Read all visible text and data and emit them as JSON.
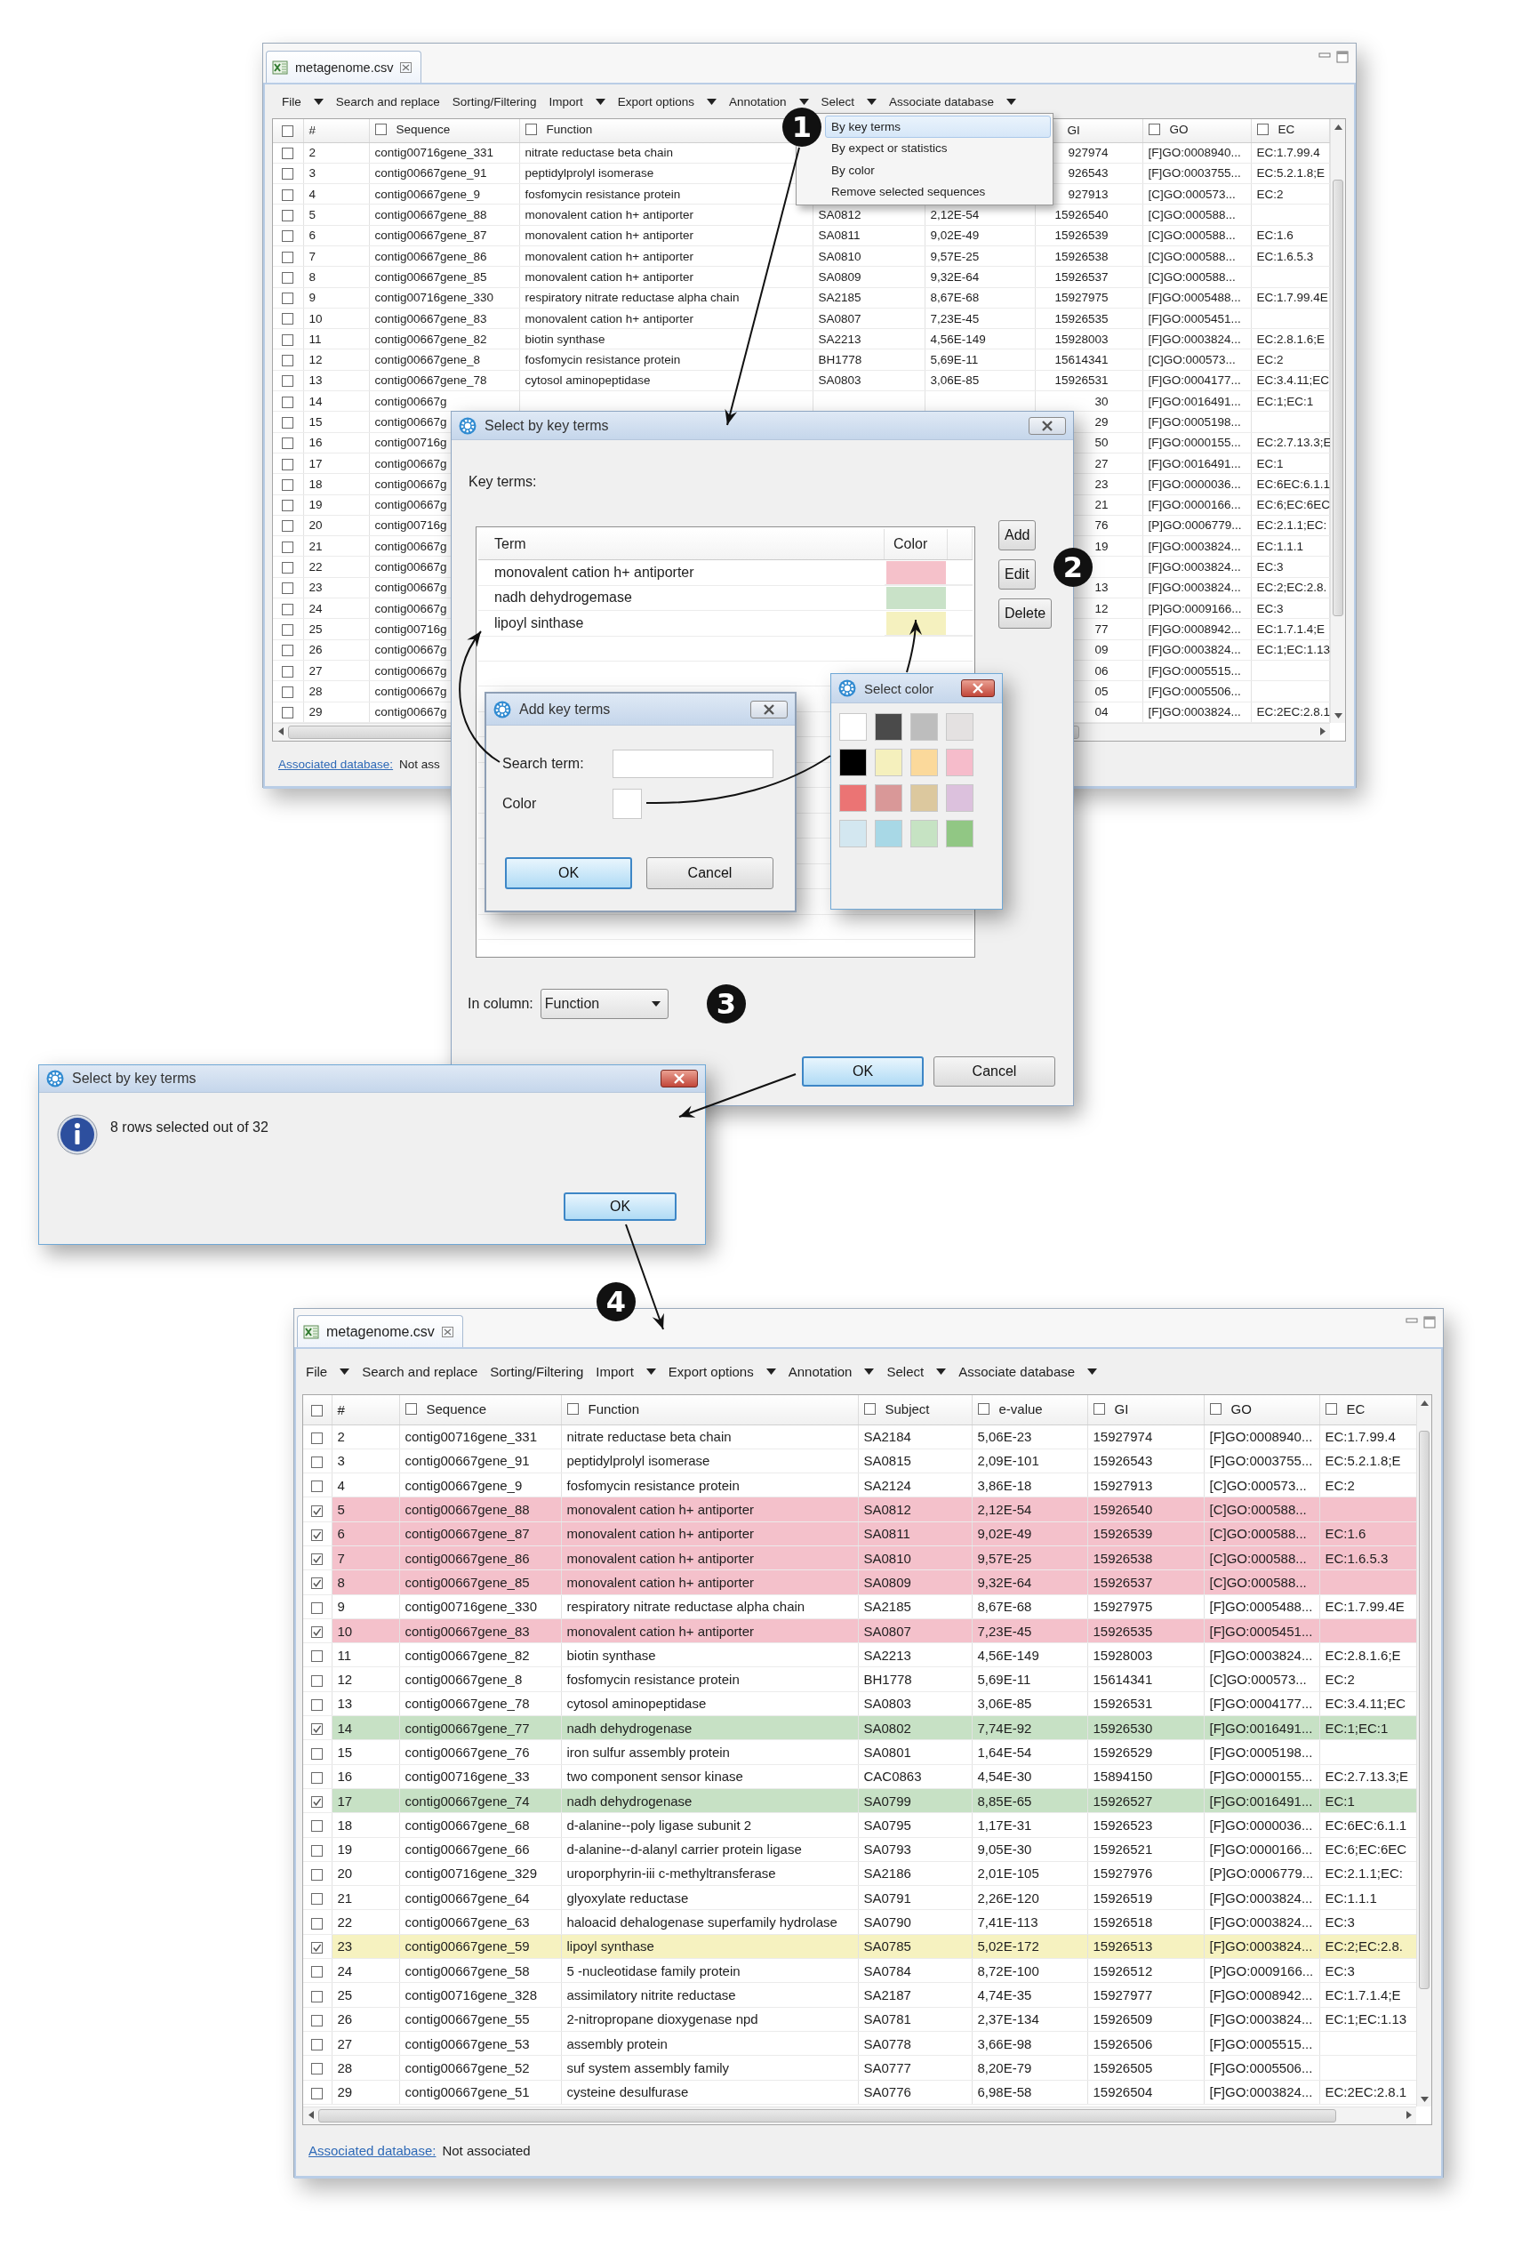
{
  "main_window": {
    "tab": {
      "title": "metagenome.csv"
    },
    "toolbar": [
      {
        "label": "File",
        "dropdown": true
      },
      {
        "label": "Search and replace",
        "dropdown": false
      },
      {
        "label": "Sorting/Filtering",
        "dropdown": false
      },
      {
        "label": "Import",
        "dropdown": true
      },
      {
        "label": "Export options",
        "dropdown": true
      },
      {
        "label": "Annotation",
        "dropdown": true
      },
      {
        "label": "Select",
        "dropdown": true
      },
      {
        "label": "Associate database",
        "dropdown": true
      }
    ],
    "select_menu": [
      {
        "label": "By key terms",
        "selected": true
      },
      {
        "label": "By expect or statistics",
        "selected": false
      },
      {
        "label": "By color",
        "selected": false
      },
      {
        "label": "Remove selected sequences",
        "selected": false
      }
    ],
    "table": {
      "select_all": {
        "checked": false
      },
      "columns": [
        {
          "label": "#"
        },
        {
          "label": "Sequence",
          "checked": false
        },
        {
          "label": "Function",
          "checked": false
        },
        null,
        null,
        {
          "label": "GI"
        },
        {
          "label": "GO",
          "checked": false
        },
        {
          "label": "EC",
          "checked": false
        }
      ],
      "rows": [
        {
          "checked": false,
          "cells": [
            "2",
            "contig00716gene_331",
            "nitrate reductase beta chain",
            null,
            null,
            "927974",
            "[F]GO:0008940...",
            "EC:1.7.99.4"
          ]
        },
        {
          "checked": false,
          "cells": [
            "3",
            "contig00667gene_91",
            "peptidylprolyl isomerase",
            null,
            null,
            "926543",
            "[F]GO:0003755...",
            "EC:5.2.1.8;E"
          ]
        },
        {
          "checked": false,
          "cells": [
            "4",
            "contig00667gene_9",
            "fosfomycin resistance protein",
            null,
            null,
            "927913",
            "[C]GO:000573...",
            "EC:2"
          ]
        },
        {
          "checked": false,
          "cells": [
            "5",
            "contig00667gene_88",
            "monovalent cation h+ antiporter",
            "SA0812",
            "2,12E-54",
            "15926540",
            "[C]GO:000588...",
            null
          ]
        },
        {
          "checked": false,
          "cells": [
            "6",
            "contig00667gene_87",
            "monovalent cation h+ antiporter",
            "SA0811",
            "9,02E-49",
            "15926539",
            "[C]GO:000588...",
            "EC:1.6"
          ]
        },
        {
          "checked": false,
          "cells": [
            "7",
            "contig00667gene_86",
            "monovalent cation h+ antiporter",
            "SA0810",
            "9,57E-25",
            "15926538",
            "[C]GO:000588...",
            "EC:1.6.5.3"
          ]
        },
        {
          "checked": false,
          "cells": [
            "8",
            "contig00667gene_85",
            "monovalent cation h+ antiporter",
            "SA0809",
            "9,32E-64",
            "15926537",
            "[C]GO:000588...",
            null
          ]
        },
        {
          "checked": false,
          "cells": [
            "9",
            "contig00716gene_330",
            "respiratory nitrate reductase alpha chain",
            "SA2185",
            "8,67E-68",
            "15927975",
            "[F]GO:0005488...",
            "EC:1.7.99.4E"
          ]
        },
        {
          "checked": false,
          "cells": [
            "10",
            "contig00667gene_83",
            "monovalent cation h+ antiporter",
            "SA0807",
            "7,23E-45",
            "15926535",
            "[F]GO:0005451...",
            null
          ]
        },
        {
          "checked": false,
          "cells": [
            "11",
            "contig00667gene_82",
            "biotin synthase",
            "SA2213",
            "4,56E-149",
            "15928003",
            "[F]GO:0003824...",
            "EC:2.8.1.6;E"
          ]
        },
        {
          "checked": false,
          "cells": [
            "12",
            "contig00667gene_8",
            "fosfomycin resistance protein",
            "BH1778",
            "5,69E-11",
            "15614341",
            "[C]GO:000573...",
            "EC:2"
          ]
        },
        {
          "checked": false,
          "cells": [
            "13",
            "contig00667gene_78",
            "cytosol aminopeptidase",
            "SA0803",
            "3,06E-85",
            "15926531",
            "[F]GO:0004177...",
            "EC:3.4.11;EC"
          ]
        },
        {
          "checked": false,
          "cells": [
            "14",
            "contig00667g",
            null,
            null,
            null,
            "30",
            "[F]GO:0016491...",
            "EC:1;EC:1"
          ]
        },
        {
          "checked": false,
          "cells": [
            "15",
            "contig00667g",
            null,
            null,
            null,
            "29",
            "[F]GO:0005198...",
            null
          ]
        },
        {
          "checked": false,
          "cells": [
            "16",
            "contig00716g",
            null,
            null,
            null,
            "50",
            "[F]GO:0000155...",
            "EC:2.7.13.3;E"
          ]
        },
        {
          "checked": false,
          "cells": [
            "17",
            "contig00667g",
            null,
            null,
            null,
            "27",
            "[F]GO:0016491...",
            "EC:1"
          ]
        },
        {
          "checked": false,
          "cells": [
            "18",
            "contig00667g",
            null,
            null,
            null,
            "23",
            "[F]GO:0000036...",
            "EC:6EC:6.1.1"
          ]
        },
        {
          "checked": false,
          "cells": [
            "19",
            "contig00667g",
            null,
            null,
            null,
            "21",
            "[F]GO:0000166...",
            "EC:6;EC:6EC"
          ]
        },
        {
          "checked": false,
          "cells": [
            "20",
            "contig00716g",
            null,
            null,
            null,
            "76",
            "[P]GO:0006779...",
            "EC:2.1.1;EC:"
          ]
        },
        {
          "checked": false,
          "cells": [
            "21",
            "contig00667g",
            null,
            null,
            null,
            "19",
            "[F]GO:0003824...",
            "EC:1.1.1"
          ]
        },
        {
          "checked": false,
          "cells": [
            "22",
            "contig00667g",
            null,
            null,
            null,
            null,
            "[F]GO:0003824...",
            "EC:3"
          ]
        },
        {
          "checked": false,
          "cells": [
            "23",
            "contig00667g",
            null,
            null,
            null,
            "13",
            "[F]GO:0003824...",
            "EC:2;EC:2.8."
          ]
        },
        {
          "checked": false,
          "cells": [
            "24",
            "contig00667g",
            null,
            null,
            null,
            "12",
            "[P]GO:0009166...",
            "EC:3"
          ]
        },
        {
          "checked": false,
          "cells": [
            "25",
            "contig00716g",
            null,
            null,
            null,
            "77",
            "[F]GO:0008942...",
            "EC:1.7.1.4;E"
          ]
        },
        {
          "checked": false,
          "cells": [
            "26",
            "contig00667g",
            null,
            null,
            null,
            "09",
            "[F]GO:0003824...",
            "EC:1;EC:1.13"
          ]
        },
        {
          "checked": false,
          "cells": [
            "27",
            "contig00667g",
            null,
            null,
            null,
            "06",
            "[F]GO:0005515...",
            null
          ]
        },
        {
          "checked": false,
          "cells": [
            "28",
            "contig00667g",
            null,
            null,
            null,
            "05",
            "[F]GO:0005506...",
            null
          ]
        },
        {
          "checked": false,
          "cells": [
            "29",
            "contig00667g",
            null,
            null,
            null,
            "04",
            "[F]GO:0003824...",
            "EC:2EC:2.8.1"
          ]
        }
      ]
    },
    "status_bar": {
      "link": "Associated database:",
      "value": "Not ass"
    }
  },
  "select_dialog": {
    "title": "Select by key terms",
    "active": false,
    "label": "Key terms:",
    "columns": [
      "Term",
      "Color"
    ],
    "terms": [
      {
        "term": "monovalent cation h+ antiporter",
        "color": "#f5c1ca"
      },
      {
        "term": "nadh dehydrogemase",
        "color": "#c9e2c8"
      },
      {
        "term": "lipoyl sinthase",
        "color": "#f5f1bf"
      }
    ],
    "buttons": [
      "Add",
      "Edit",
      "Delete"
    ],
    "column_label": "In column:",
    "column_value": "Function",
    "actions": [
      {
        "label": "OK",
        "default": true
      },
      {
        "label": "Cancel",
        "default": false
      }
    ]
  },
  "add_dialog": {
    "title": "Add key terms",
    "active": false,
    "search_label": "Search term:",
    "color_label": "Color",
    "color": "#ffffff",
    "actions": [
      {
        "label": "OK",
        "default": true
      },
      {
        "label": "Cancel",
        "default": false
      }
    ]
  },
  "color_dialog": {
    "title": "Select color",
    "active": true,
    "swatches": [
      {
        "color": "#ffffff"
      },
      {
        "color": "#4a4a4a"
      },
      {
        "color": "#bdbdbd"
      },
      {
        "color": "#e4e1e1"
      },
      {
        "color": "#000000"
      },
      {
        "color": "#f5f0bd"
      },
      {
        "color": "#fbd99b"
      },
      {
        "color": "#f6bccb"
      },
      {
        "color": "#eb7474"
      },
      {
        "color": "#d99898"
      },
      {
        "color": "#dcc89e"
      },
      {
        "color": "#dcc1dd"
      },
      {
        "color": "#d3e7f0"
      },
      {
        "color": "#a8d8e6"
      },
      {
        "color": "#c6e3c3"
      },
      {
        "color": "#91c784"
      }
    ]
  },
  "info_dialog": {
    "title": "Select by key terms",
    "active": true,
    "message": "8 rows selected out of 32",
    "actions": [
      {
        "label": "OK",
        "default": true
      }
    ]
  },
  "result_window": {
    "tab": {
      "title": "metagenome.csv"
    },
    "toolbar": [
      {
        "label": "File",
        "dropdown": true
      },
      {
        "label": "Search and replace",
        "dropdown": false
      },
      {
        "label": "Sorting/Filtering",
        "dropdown": false
      },
      {
        "label": "Import",
        "dropdown": true
      },
      {
        "label": "Export options",
        "dropdown": true
      },
      {
        "label": "Annotation",
        "dropdown": true
      },
      {
        "label": "Select",
        "dropdown": true
      },
      {
        "label": "Associate database",
        "dropdown": true
      }
    ],
    "table": {
      "select_all": {
        "checked": false
      },
      "columns": [
        {
          "label": "#"
        },
        {
          "label": "Sequence",
          "checked": false
        },
        {
          "label": "Function",
          "checked": false
        },
        {
          "label": "Subject",
          "checked": false
        },
        {
          "label": "e-value",
          "checked": false
        },
        {
          "label": "GI",
          "checked": false
        },
        {
          "label": "GO",
          "checked": false
        },
        {
          "label": "EC",
          "checked": false
        }
      ],
      "rows": [
        {
          "checked": false,
          "cells": [
            "2",
            "contig00716gene_331",
            "nitrate reductase beta chain",
            "SA2184",
            "5,06E-23",
            "15927974",
            "[F]GO:0008940...",
            "EC:1.7.99.4"
          ]
        },
        {
          "checked": false,
          "cells": [
            "3",
            "contig00667gene_91",
            "peptidylprolyl isomerase",
            "SA0815",
            "2,09E-101",
            "15926543",
            "[F]GO:0003755...",
            "EC:5.2.1.8;E"
          ]
        },
        {
          "checked": false,
          "cells": [
            "4",
            "contig00667gene_9",
            "fosfomycin resistance protein",
            "SA2124",
            "3,86E-18",
            "15927913",
            "[C]GO:000573...",
            "EC:2"
          ]
        },
        {
          "checked": true,
          "color": "#f4c1cb",
          "cells": [
            "5",
            "contig00667gene_88",
            "monovalent cation h+ antiporter",
            "SA0812",
            "2,12E-54",
            "15926540",
            "[C]GO:000588...",
            null
          ]
        },
        {
          "checked": true,
          "color": "#f4c1cb",
          "cells": [
            "6",
            "contig00667gene_87",
            "monovalent cation h+ antiporter",
            "SA0811",
            "9,02E-49",
            "15926539",
            "[C]GO:000588...",
            "EC:1.6"
          ]
        },
        {
          "checked": true,
          "color": "#f4c1cb",
          "cells": [
            "7",
            "contig00667gene_86",
            "monovalent cation h+ antiporter",
            "SA0810",
            "9,57E-25",
            "15926538",
            "[C]GO:000588...",
            "EC:1.6.5.3"
          ]
        },
        {
          "checked": true,
          "color": "#f4c1cb",
          "cells": [
            "8",
            "contig00667gene_85",
            "monovalent cation h+ antiporter",
            "SA0809",
            "9,32E-64",
            "15926537",
            "[C]GO:000588...",
            null
          ]
        },
        {
          "checked": false,
          "cells": [
            "9",
            "contig00716gene_330",
            "respiratory nitrate reductase alpha chain",
            "SA2185",
            "8,67E-68",
            "15927975",
            "[F]GO:0005488...",
            "EC:1.7.99.4E"
          ]
        },
        {
          "checked": true,
          "color": "#f4c1cb",
          "cells": [
            "10",
            "contig00667gene_83",
            "monovalent cation h+ antiporter",
            "SA0807",
            "7,23E-45",
            "15926535",
            "[F]GO:0005451...",
            null
          ]
        },
        {
          "checked": false,
          "cells": [
            "11",
            "contig00667gene_82",
            "biotin synthase",
            "SA2213",
            "4,56E-149",
            "15928003",
            "[F]GO:0003824...",
            "EC:2.8.1.6;E"
          ]
        },
        {
          "checked": false,
          "cells": [
            "12",
            "contig00667gene_8",
            "fosfomycin resistance protein",
            "BH1778",
            "5,69E-11",
            "15614341",
            "[C]GO:000573...",
            "EC:2"
          ]
        },
        {
          "checked": false,
          "cells": [
            "13",
            "contig00667gene_78",
            "cytosol aminopeptidase",
            "SA0803",
            "3,06E-85",
            "15926531",
            "[F]GO:0004177...",
            "EC:3.4.11;EC"
          ]
        },
        {
          "checked": true,
          "color": "#c7e1c5",
          "cells": [
            "14",
            "contig00667gene_77",
            "nadh dehydrogenase",
            "SA0802",
            "7,74E-92",
            "15926530",
            "[F]GO:0016491...",
            "EC:1;EC:1"
          ]
        },
        {
          "checked": false,
          "cells": [
            "15",
            "contig00667gene_76",
            "iron sulfur assembly protein",
            "SA0801",
            "1,64E-54",
            "15926529",
            "[F]GO:0005198...",
            null
          ]
        },
        {
          "checked": false,
          "cells": [
            "16",
            "contig00716gene_33",
            "two component sensor kinase",
            "CAC0863",
            "4,54E-30",
            "15894150",
            "[F]GO:0000155...",
            "EC:2.7.13.3;E"
          ]
        },
        {
          "checked": true,
          "color": "#c7e1c5",
          "cells": [
            "17",
            "contig00667gene_74",
            "nadh dehydrogenase",
            "SA0799",
            "8,85E-65",
            "15926527",
            "[F]GO:0016491...",
            "EC:1"
          ]
        },
        {
          "checked": false,
          "cells": [
            "18",
            "contig00667gene_68",
            "d-alanine--poly ligase subunit 2",
            "SA0795",
            "1,17E-31",
            "15926523",
            "[F]GO:0000036...",
            "EC:6EC:6.1.1"
          ]
        },
        {
          "checked": false,
          "cells": [
            "19",
            "contig00667gene_66",
            "d-alanine--d-alanyl carrier protein ligase",
            "SA0793",
            "9,05E-30",
            "15926521",
            "[F]GO:0000166...",
            "EC:6;EC:6EC"
          ]
        },
        {
          "checked": false,
          "cells": [
            "20",
            "contig00716gene_329",
            "uroporphyrin-iii c-methyltransferase",
            "SA2186",
            "2,01E-105",
            "15927976",
            "[P]GO:0006779...",
            "EC:2.1.1;EC:"
          ]
        },
        {
          "checked": false,
          "cells": [
            "21",
            "contig00667gene_64",
            "glyoxylate reductase",
            "SA0791",
            "2,26E-120",
            "15926519",
            "[F]GO:0003824...",
            "EC:1.1.1"
          ]
        },
        {
          "checked": false,
          "cells": [
            "22",
            "contig00667gene_63",
            "haloacid dehalogenase superfamily hydrolase",
            "SA0790",
            "7,41E-113",
            "15926518",
            "[F]GO:0003824...",
            "EC:3"
          ]
        },
        {
          "checked": true,
          "color": "#f6f2c0",
          "cells": [
            "23",
            "contig00667gene_59",
            "lipoyl synthase",
            "SA0785",
            "5,02E-172",
            "15926513",
            "[F]GO:0003824...",
            "EC:2;EC:2.8."
          ]
        },
        {
          "checked": false,
          "cells": [
            "24",
            "contig00667gene_58",
            "5 -nucleotidase family protein",
            "SA0784",
            "8,72E-100",
            "15926512",
            "[P]GO:0009166...",
            "EC:3"
          ]
        },
        {
          "checked": false,
          "cells": [
            "25",
            "contig00716gene_328",
            "assimilatory nitrite reductase",
            "SA2187",
            "4,74E-35",
            "15927977",
            "[F]GO:0008942...",
            "EC:1.7.1.4;E"
          ]
        },
        {
          "checked": false,
          "cells": [
            "26",
            "contig00667gene_55",
            "2-nitropropane dioxygenase npd",
            "SA0781",
            "2,37E-134",
            "15926509",
            "[F]GO:0003824...",
            "EC:1;EC:1.13"
          ]
        },
        {
          "checked": false,
          "cells": [
            "27",
            "contig00667gene_53",
            "assembly protein",
            "SA0778",
            "3,66E-98",
            "15926506",
            "[F]GO:0005515...",
            null
          ]
        },
        {
          "checked": false,
          "cells": [
            "28",
            "contig00667gene_52",
            "suf system assembly family",
            "SA0777",
            "8,20E-79",
            "15926505",
            "[F]GO:0005506...",
            null
          ]
        },
        {
          "checked": false,
          "cells": [
            "29",
            "contig00667gene_51",
            "cysteine desulfurase",
            "SA0776",
            "6,98E-58",
            "15926504",
            "[F]GO:0003824...",
            "EC:2EC:2.8.1"
          ]
        }
      ]
    },
    "status_bar": {
      "link": "Associated database:",
      "value": "Not associated"
    }
  },
  "callouts": [
    "1",
    "2",
    "3",
    "4"
  ]
}
